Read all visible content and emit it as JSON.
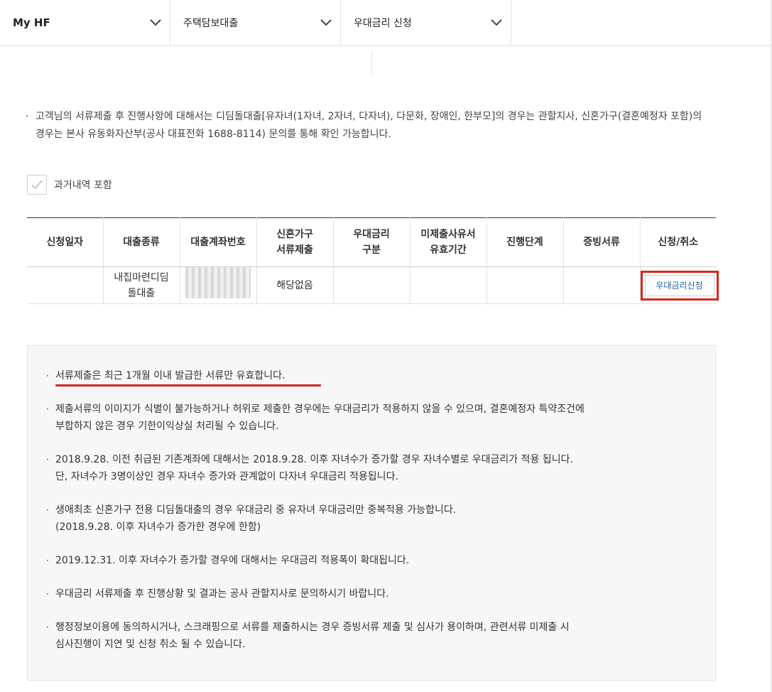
{
  "nav": {
    "items": [
      {
        "label": "My HF"
      },
      {
        "label": "주택담보대출"
      },
      {
        "label": "우대금리 신청"
      }
    ]
  },
  "notice": {
    "bullet": "·",
    "text": "고객님의 서류제출 후 진행사항에 대해서는 디딤돌대출[유자녀(1자녀, 2자녀, 다자녀), 다문화, 장애인, 한부모]의 경우는 관할지사, 신혼가구(결혼예정자 포함)의 경우는 본사 유동화자산부(공사 대표전화 1688-8114) 문의를 통해 확인 가능합니다."
  },
  "filter": {
    "include_past_label": "과거내역 포함",
    "include_past_checked": true
  },
  "table": {
    "headers": [
      {
        "line1": "신청일자",
        "line2": ""
      },
      {
        "line1": "대출종류",
        "line2": ""
      },
      {
        "line1": "대출계좌번호",
        "line2": ""
      },
      {
        "line1": "신혼가구",
        "line2": "서류제출"
      },
      {
        "line1": "우대금리",
        "line2": "구분"
      },
      {
        "line1": "미제출사유서",
        "line2": "유효기간"
      },
      {
        "line1": "진행단계",
        "line2": ""
      },
      {
        "line1": "증빙서류",
        "line2": ""
      },
      {
        "line1": "신청/취소",
        "line2": ""
      }
    ],
    "rows": [
      {
        "date": "",
        "loan_type_line1": "내집마련디딤",
        "loan_type_line2": "돌대출",
        "account": "",
        "newlywed_docs": "해당없음",
        "rate_type": "",
        "unsubmitted_validity": "",
        "stage": "",
        "evidence": "",
        "action_label": "우대금리신청"
      }
    ]
  },
  "info": {
    "bullet": "·",
    "items": [
      {
        "lines": [
          "서류제출은 최근 1개월 이내 발급한 서류만 유효합니다."
        ],
        "highlight": true
      },
      {
        "lines": [
          "제출서류의 이미지가 식별이 불가능하거나 허위로 제출한 경우에는 우대금리가 적용하지 않을 수 있으며, 결혼예정자 특약조건에",
          "부합하지 않은 경우 기한이익상실 처리될 수 있습니다."
        ]
      },
      {
        "lines": [
          "2018.9.28. 이전 취급된 기존계좌에 대해서는 2018.9.28. 이후 자녀수가 증가할 경우 자녀수별로 우대금리가 적용 됩니다.",
          "단, 자녀수가 3명이상인 경우 자녀수 증가와 관계없이 다자녀 우대금리 적용됩니다."
        ]
      },
      {
        "lines": [
          "생애최초 신혼가구 전용 디딤돌대출의 경우 우대금리 중 유자녀 우대금리만 중복적용 가능합니다.",
          "(2018.9.28. 이후 자녀수가 증가한 경우에 한함)"
        ]
      },
      {
        "lines": [
          "2019.12.31. 이후 자녀수가 증가할 경우에 대해서는 우대금리 적용폭이 확대됩니다."
        ]
      },
      {
        "lines": [
          "우대금리 서류제출 후 진행상황 및 결과는 공사 관할지사로 문의하시기 바랍니다."
        ]
      },
      {
        "lines": [
          "행정정보이용에 동의하시거나, 스크래핑으로 서류를 제출하시는 경우 증빙서류 제출 및 심사가 용이하며, 관련서류 미제출 시",
          "심사진행이 지연 및 신청 취소 될 수 있습니다."
        ]
      }
    ]
  },
  "colors": {
    "highlight_red": "#d9251d",
    "link_blue": "#1b5fa8"
  }
}
